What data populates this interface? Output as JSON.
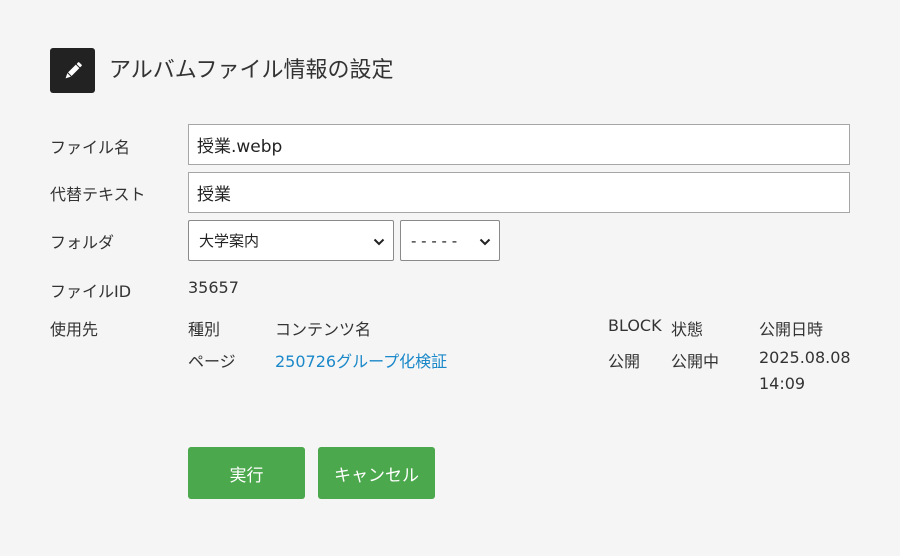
{
  "title": "アルバムファイル情報の設定",
  "icons": {
    "header": "pencil-icon",
    "select": "chevron-down-icon"
  },
  "colors": {
    "accent": "#4ca84d",
    "link": "#1a88c9",
    "icon_bg": "#222222"
  },
  "form": {
    "filename": {
      "label": "ファイル名",
      "value": "授業.webp"
    },
    "alt_text": {
      "label": "代替テキスト",
      "value": "授業"
    },
    "folder": {
      "label": "フォルダ",
      "selected": "大学案内",
      "sub_selected": "- - - - -"
    },
    "file_id": {
      "label": "ファイルID",
      "value": "35657"
    }
  },
  "usage": {
    "label": "使用先",
    "headers": {
      "type": "種別",
      "content": "コンテンツ名",
      "block": "BLOCK",
      "status": "状態",
      "published": "公開日時"
    },
    "rows": [
      {
        "type": "ページ",
        "content": "250726グループ化検証",
        "block": "公開",
        "status": "公開中",
        "published_date": "2025.08.08",
        "published_time": "14:09"
      }
    ]
  },
  "buttons": {
    "execute": "実行",
    "cancel": "キャンセル"
  }
}
